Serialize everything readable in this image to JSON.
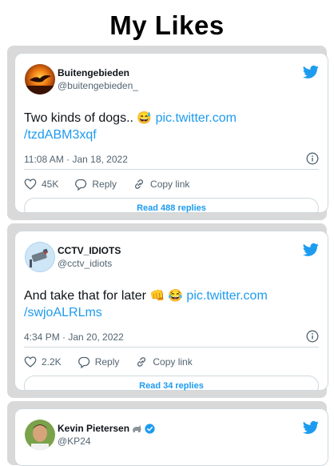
{
  "page": {
    "title": "My Likes"
  },
  "tweets": [
    {
      "display_name": "Buitengebieden",
      "handle": "@buitengebieden_",
      "text": "Two kinds of dogs..",
      "emoji": "😅",
      "link_line1": "pic.twitter.com",
      "link_line2": "/tzdABM3xqf",
      "timestamp": "11:08 AM · Jan 18, 2022",
      "likes": "45K",
      "reply_label": "Reply",
      "copy_label": "Copy link",
      "read_label": "Read 488 replies"
    },
    {
      "display_name": "CCTV_IDIOTS",
      "handle": "@cctv_idiots",
      "text": "And take that for later",
      "emoji": "👊 😂",
      "link_line1": "pic.twitter.com",
      "link_line2": "/swjoALRLms",
      "timestamp": "4:34 PM · Jan 20, 2022",
      "likes": "2.2K",
      "reply_label": "Reply",
      "copy_label": "Copy link",
      "read_label": "Read 34 replies"
    },
    {
      "display_name": "Kevin Pietersen",
      "handle": "@KP24"
    }
  ],
  "colors": {
    "accent": "#1d9bf0",
    "frame": "#d9d9d9",
    "muted": "#536471"
  }
}
